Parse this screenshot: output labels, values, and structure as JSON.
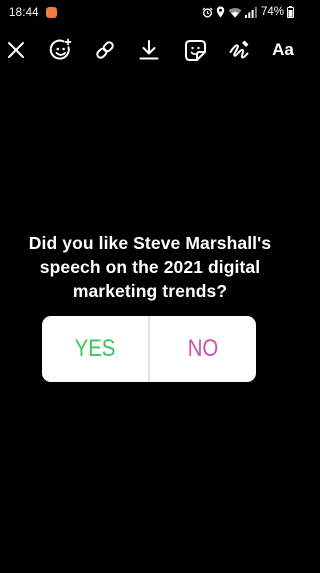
{
  "status_bar": {
    "time": "18:44",
    "battery": "74%",
    "icons": [
      "notification-icon",
      "alarm-icon",
      "location-icon",
      "wifi-icon",
      "signal-icon",
      "battery-icon"
    ]
  },
  "toolbar": {
    "close": "close-icon",
    "effects": "face-effects-icon",
    "link": "link-icon",
    "download": "download-icon",
    "sticker": "sticker-icon",
    "draw": "draw-icon",
    "text_label": "Aa"
  },
  "question": {
    "line1": "Did you like Steve Marshall's",
    "line2": "speech on the 2021 digital",
    "line3": "marketing trends?"
  },
  "poll": {
    "yes_label": "YES",
    "no_label": "NO",
    "yes_color": "#3fc45a",
    "no_color": "#d04fb0"
  }
}
